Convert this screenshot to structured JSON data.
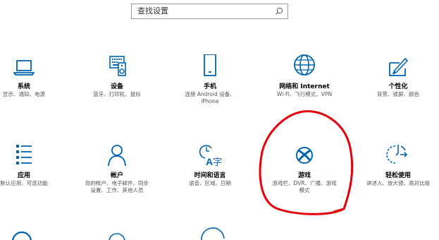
{
  "search": {
    "placeholder": "查找设置"
  },
  "tiles": [
    {
      "title": "系统",
      "desc": "显示、通知、电源"
    },
    {
      "title": "设备",
      "desc": "蓝牙、打印机、鼠标"
    },
    {
      "title": "手机",
      "desc": "连接 Android 设备、\niPhone"
    },
    {
      "title": "网络和 Internet",
      "desc": "Wi-Fi、飞行模式、VPN"
    },
    {
      "title": "个性化",
      "desc": "背景、锁屏、颜色"
    },
    {
      "title": "应用",
      "desc": "默认应用、可选功能"
    },
    {
      "title": "帐户",
      "desc": "你的帐户、电子邮件、同步\n设置、工作、其他人员"
    },
    {
      "title": "时间和语言",
      "desc": "语音、区域、日期"
    },
    {
      "title": "游戏",
      "desc": "游戏栏、DVR、广播、游戏\n模式"
    },
    {
      "title": "轻松使用",
      "desc": "讲述人、放大镜、高对比度"
    }
  ],
  "colors": {
    "accent": "#0063b1",
    "annotation": "#e3000b"
  },
  "icons": [
    "laptop-icon",
    "keyboard-speaker-icon",
    "phone-icon",
    "globe-icon",
    "paint-brush-icon",
    "app-list-icon",
    "person-icon",
    "time-language-icon",
    "xbox-icon",
    "ease-of-access-icon"
  ]
}
